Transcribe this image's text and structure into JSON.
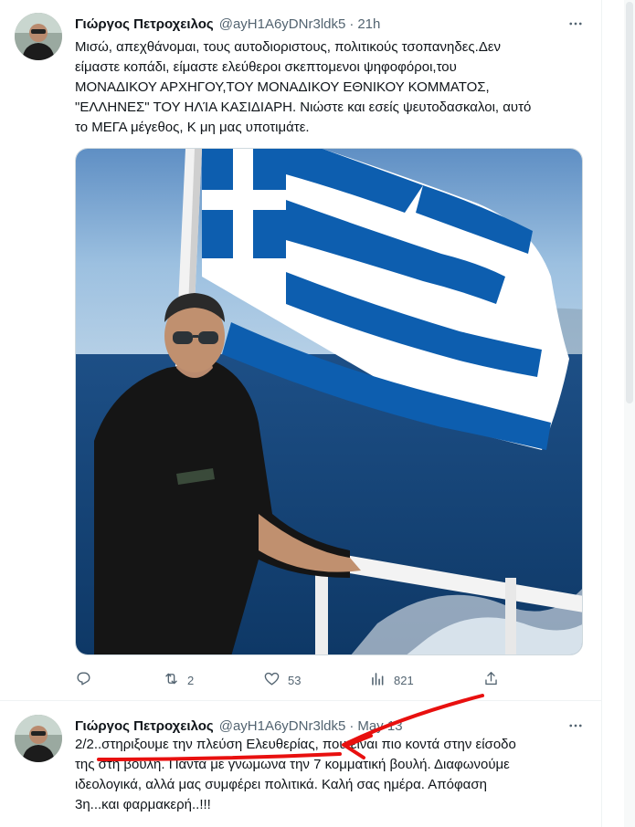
{
  "tweets": [
    {
      "display_name": "Γιώργος Πετροχειλος",
      "handle": "@ayH1A6yDNr3ldk5",
      "separator": "·",
      "time": "21h",
      "text_lines": [
        "Μισώ, απεχθάνομαι, τους αυτοδιοριστους, πολιτικούς τσοπανηδες.Δεν",
        "είμαστε κοπάδι, είμαστε ελεύθεροι σκεπτομενοι ψηφοφόροι,του",
        "ΜΟΝΑΔΙΚΟΥ ΑΡΧΗΓΟΥ,ΤΟΥ ΜΟΝΑΔΙΚΟΥ ΕΘΝΙΚΟΥ ΚΟΜΜΑΤΟΣ,",
        "\"ΕΛΛΗΝΕΣ\" ΤΟΥ ΗΛΊΑ ΚΑΣΙΔΙΑΡΗ. Νιώστε και εσείς ψευτοδασκαλοι, αυτό",
        "το ΜΕΓΑ μέγεθος, Κ μη μας υποτιμάτε."
      ],
      "actions": {
        "reply": {
          "icon": "reply-icon",
          "count": ""
        },
        "retweet": {
          "icon": "retweet-icon",
          "count": "2"
        },
        "like": {
          "icon": "heart-icon",
          "count": "53"
        },
        "views": {
          "icon": "views-icon",
          "count": "821"
        },
        "share": {
          "icon": "share-icon",
          "count": ""
        }
      }
    },
    {
      "display_name": "Γιώργος Πετροχειλος",
      "handle": "@ayH1A6yDNr3ldk5",
      "separator": "·",
      "time": "May 13",
      "text_lines": [
        "2/2..στηριξουμε την πλεύση Ελευθερίας, που ειναι πιο κοντά στην είσοδο",
        "της στη βουλή. Πάντα με γνωμωνα την 7 κομματική βουλή. Διαφωνούμε",
        "ιδεολογικά, αλλά μας συμφέρει πολιτικά. Καλή σας ημέρα. Απόφαση",
        "3η...και φαρμακερή..!!!"
      ]
    }
  ],
  "colors": {
    "text": "#0f1419",
    "secondary": "#536471",
    "border": "#eff3f4",
    "annotation_red": "#e8100f",
    "flag_blue": "#0d5eaf"
  }
}
